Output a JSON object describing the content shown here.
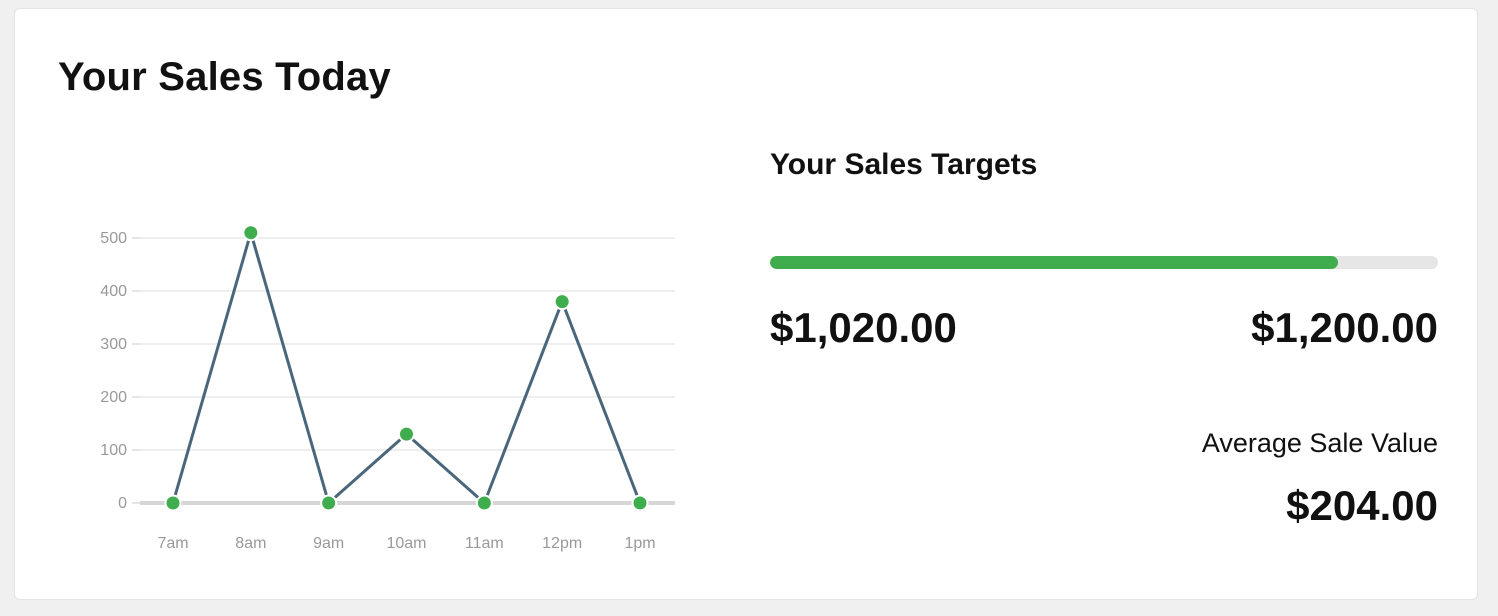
{
  "page_title": "Your Sales Today",
  "targets": {
    "title": "Your Sales Targets",
    "current": "$1,020.00",
    "target": "$1,200.00",
    "progress_fraction": 0.85
  },
  "average": {
    "label": "Average Sale Value",
    "value": "$204.00"
  },
  "colors": {
    "line": "#4a667a",
    "point": "#3fad4e",
    "progress_fill": "#3fad4e",
    "progress_track": "#e6e6e6",
    "grid": "#e8e8e8",
    "tick_text": "#999999"
  },
  "chart_data": {
    "type": "line",
    "categories": [
      "7am",
      "8am",
      "9am",
      "10am",
      "11am",
      "12pm",
      "1pm"
    ],
    "values": [
      0,
      510,
      0,
      130,
      0,
      380,
      0
    ],
    "ylim": [
      0,
      500
    ],
    "yticks": [
      0,
      100,
      200,
      300,
      400,
      500
    ],
    "grid": true,
    "title": "",
    "xlabel": "",
    "ylabel": ""
  }
}
